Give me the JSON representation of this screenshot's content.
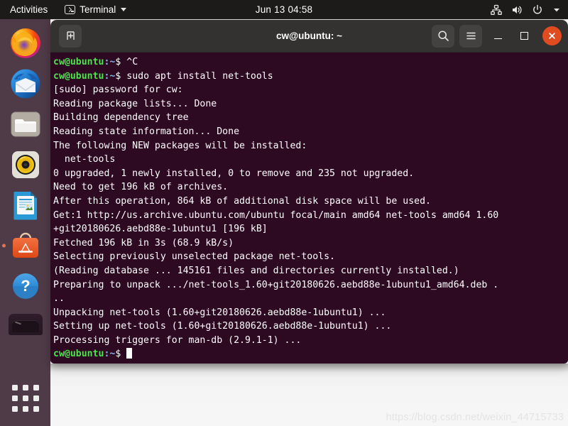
{
  "topbar": {
    "activities": "Activities",
    "app_menu": {
      "icon": "terminal-icon",
      "label": "Terminal",
      "caret": "chevron-down-icon"
    },
    "clock": "Jun 13  04:58",
    "indicators": [
      {
        "name": "network-icon",
        "label": "Network"
      },
      {
        "name": "volume-icon",
        "label": "Volume"
      },
      {
        "name": "power-icon",
        "label": "Power"
      },
      {
        "name": "chevron-down-icon",
        "label": "System menu"
      }
    ]
  },
  "dock": {
    "items": [
      {
        "name": "firefox",
        "label": "Firefox",
        "running": false
      },
      {
        "name": "thunderbird",
        "label": "Thunderbird Mail",
        "running": false
      },
      {
        "name": "files",
        "label": "Files",
        "running": false
      },
      {
        "name": "rhythmbox",
        "label": "Rhythmbox",
        "running": false
      },
      {
        "name": "libreoffice-writer",
        "label": "LibreOffice Writer",
        "running": false
      },
      {
        "name": "ubuntu-software",
        "label": "Ubuntu Software",
        "running": true
      },
      {
        "name": "help",
        "label": "Help",
        "running": false
      }
    ],
    "drive_label": "Drive",
    "show_apps_label": "Show Applications"
  },
  "window": {
    "title": "cw@ubuntu: ~",
    "new_tab_label": "New Tab",
    "search_label": "Search",
    "menu_label": "Main Menu",
    "minimize_label": "Minimize",
    "maximize_label": "Maximize",
    "close_label": "Close",
    "accent_close_color": "#e04b20",
    "background_color": "#2d0922",
    "titlebar_color": "#333231"
  },
  "terminal": {
    "prompt_user": "cw@ubuntu",
    "prompt_path": ":~",
    "prompt_sym": "$ ",
    "lines": [
      {
        "type": "prompt",
        "text": "^C"
      },
      {
        "type": "prompt",
        "text": "sudo apt install net-tools"
      },
      {
        "type": "out",
        "text": "[sudo] password for cw:"
      },
      {
        "type": "out",
        "text": "Reading package lists... Done"
      },
      {
        "type": "out",
        "text": "Building dependency tree"
      },
      {
        "type": "out",
        "text": "Reading state information... Done"
      },
      {
        "type": "out",
        "text": "The following NEW packages will be installed:"
      },
      {
        "type": "out",
        "text": "  net-tools"
      },
      {
        "type": "out",
        "text": "0 upgraded, 1 newly installed, 0 to remove and 235 not upgraded."
      },
      {
        "type": "out",
        "text": "Need to get 196 kB of archives."
      },
      {
        "type": "out",
        "text": "After this operation, 864 kB of additional disk space will be used."
      },
      {
        "type": "out",
        "text": "Get:1 http://us.archive.ubuntu.com/ubuntu focal/main amd64 net-tools amd64 1.60"
      },
      {
        "type": "out",
        "text": "+git20180626.aebd88e-1ubuntu1 [196 kB]"
      },
      {
        "type": "out",
        "text": "Fetched 196 kB in 3s (68.9 kB/s)"
      },
      {
        "type": "out",
        "text": "Selecting previously unselected package net-tools."
      },
      {
        "type": "out",
        "text": "(Reading database ... 145161 files and directories currently installed.)"
      },
      {
        "type": "out",
        "text": "Preparing to unpack .../net-tools_1.60+git20180626.aebd88e-1ubuntu1_amd64.deb ."
      },
      {
        "type": "out",
        "text": ".."
      },
      {
        "type": "out",
        "text": "Unpacking net-tools (1.60+git20180626.aebd88e-1ubuntu1) ..."
      },
      {
        "type": "out",
        "text": "Setting up net-tools (1.60+git20180626.aebd88e-1ubuntu1) ..."
      },
      {
        "type": "out",
        "text": "Processing triggers for man-db (2.9.1-1) ..."
      },
      {
        "type": "cursor",
        "text": ""
      }
    ]
  },
  "watermark": "https://blog.csdn.net/weixin_44715733"
}
